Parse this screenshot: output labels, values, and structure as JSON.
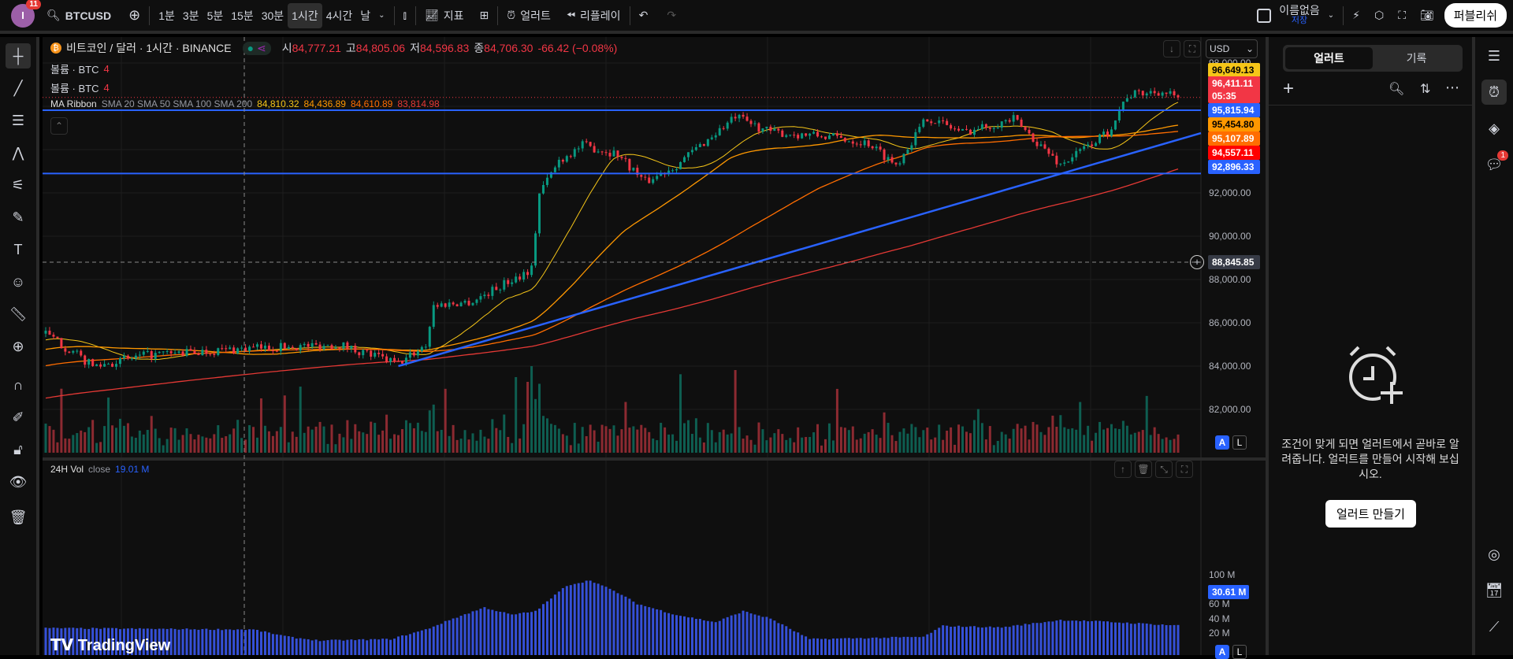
{
  "topbar": {
    "avatar_letter": "I",
    "notifications": "11",
    "symbol": "BTCUSD",
    "intervals": [
      "1분",
      "3분",
      "5분",
      "15분",
      "30분",
      "1시간",
      "4시간",
      "날"
    ],
    "active_interval": "1시간",
    "indicators_label": "지표",
    "alert_label": "얼러트",
    "replay_label": "리플레이",
    "layout_name": "이름없음",
    "save_label": "저장",
    "publish_label": "퍼블리쉬"
  },
  "legend": {
    "title": "비트코인 / 달러 · 1시간 · BINANCE",
    "o_label": "시",
    "o": "84,777.21",
    "h_label": "고",
    "h": "84,805.06",
    "l_label": "저",
    "l": "84,596.83",
    "c_label": "종",
    "c": "84,706.30",
    "change": "-66.42 (−0.08%)",
    "volume_label": "볼륨 · BTC",
    "volume_value": "4",
    "ma_label": "MA Ribbon",
    "ma_params": "SMA 20 SMA 50 SMA 100 SMA 200",
    "ma_values": [
      "84,810.32",
      "84,436.89",
      "84,610.89",
      "83,814.98"
    ],
    "vol24_label": "24H Vol",
    "vol24_source": "close",
    "vol24_value": "19.01 M"
  },
  "currency": "USD",
  "price_labels": [
    {
      "value": "96,649.13",
      "bg": "#f5c518",
      "fg": "#000"
    },
    {
      "value": "96,411.11",
      "bg": "#f23645",
      "fg": "#fff",
      "sub": "05:35"
    },
    {
      "value": "95,815.94",
      "bg": "#2962ff",
      "fg": "#fff"
    },
    {
      "value": "95,454.80",
      "bg": "#ff9800",
      "fg": "#000"
    },
    {
      "value": "95,107.89",
      "bg": "#ff6d00",
      "fg": "#fff"
    },
    {
      "value": "94,557.11",
      "bg": "#ff0000",
      "fg": "#fff"
    },
    {
      "value": "92,896.33",
      "bg": "#2962ff",
      "fg": "#fff"
    }
  ],
  "crosshair_price": "88,845.85",
  "vol24_current": "30.61 M",
  "scale_buttons": {
    "auto": "A",
    "log": "L"
  },
  "watermark": "TradingView",
  "alerts_panel": {
    "tabs": [
      "얼러트",
      "기록"
    ],
    "empty_text": "조건이 맞게 되면 얼러트에서 곧바로 알려줍니다. 얼러트를 만들어 시작해 보십시오.",
    "create_button": "얼러트 만들기"
  },
  "right_bar_badge": "1",
  "chart_data": {
    "type": "candlestick",
    "symbol": "BTCUSD",
    "interval": "1h",
    "candle_count": 290,
    "price_anchors": [
      [
        0,
        85500
      ],
      [
        12,
        84000
      ],
      [
        26,
        84500
      ],
      [
        50,
        84800
      ],
      [
        75,
        85000
      ],
      [
        90,
        84100
      ],
      [
        97,
        85000
      ],
      [
        99,
        86800
      ],
      [
        109,
        87000
      ],
      [
        117,
        87800
      ],
      [
        124,
        88500
      ],
      [
        126,
        92000
      ],
      [
        131,
        93500
      ],
      [
        137,
        94200
      ],
      [
        146,
        93800
      ],
      [
        153,
        92500
      ],
      [
        161,
        93300
      ],
      [
        176,
        95500
      ],
      [
        185,
        94800
      ],
      [
        200,
        94600
      ],
      [
        210,
        94300
      ],
      [
        217,
        93300
      ],
      [
        225,
        95500
      ],
      [
        234,
        94800
      ],
      [
        247,
        95400
      ],
      [
        259,
        93300
      ],
      [
        271,
        94800
      ],
      [
        276,
        96500
      ],
      [
        284,
        96700
      ],
      [
        289,
        96411.11
      ]
    ],
    "prehistory_start": 79500,
    "ma_periods": [
      20,
      50,
      100,
      200
    ],
    "ma_colors": [
      "#f5c518",
      "#ff9800",
      "#ff6d00",
      "#e53935"
    ],
    "vol24_anchors_M": [
      [
        0,
        27
      ],
      [
        53,
        25
      ],
      [
        62,
        15
      ],
      [
        70,
        10
      ],
      [
        88,
        12
      ],
      [
        97,
        25
      ],
      [
        104,
        40
      ],
      [
        112,
        55
      ],
      [
        119,
        45
      ],
      [
        125,
        50
      ],
      [
        133,
        85
      ],
      [
        139,
        92
      ],
      [
        146,
        75
      ],
      [
        151,
        60
      ],
      [
        161,
        45
      ],
      [
        171,
        35
      ],
      [
        178,
        50
      ],
      [
        185,
        40
      ],
      [
        195,
        12
      ],
      [
        224,
        15
      ],
      [
        229,
        30
      ],
      [
        244,
        28
      ],
      [
        259,
        38
      ],
      [
        269,
        36
      ],
      [
        289,
        30.61
      ]
    ],
    "horizontal_lines": [
      95815.94,
      92896.33
    ],
    "trend_line": [
      [
        90,
        84000
      ],
      [
        300,
        94763
      ]
    ],
    "y_ticks": [
      "98,000.00",
      "92,000.00",
      "90,000.00",
      "88,000.00",
      "86,000.00",
      "84,000.00",
      "82,000.00"
    ],
    "y_tick_values": [
      98000,
      92000,
      90000,
      88000,
      86000,
      84000,
      82000
    ],
    "vol24_ticks": [
      "100 M",
      "80 M",
      "60 M",
      "40 M",
      "20 M"
    ],
    "vol24_tick_values": [
      100,
      80,
      60,
      40,
      20
    ],
    "colors": {
      "up": "#089981",
      "down": "#f23645",
      "line": "#2962ff",
      "vol24": "#3550d8"
    }
  }
}
